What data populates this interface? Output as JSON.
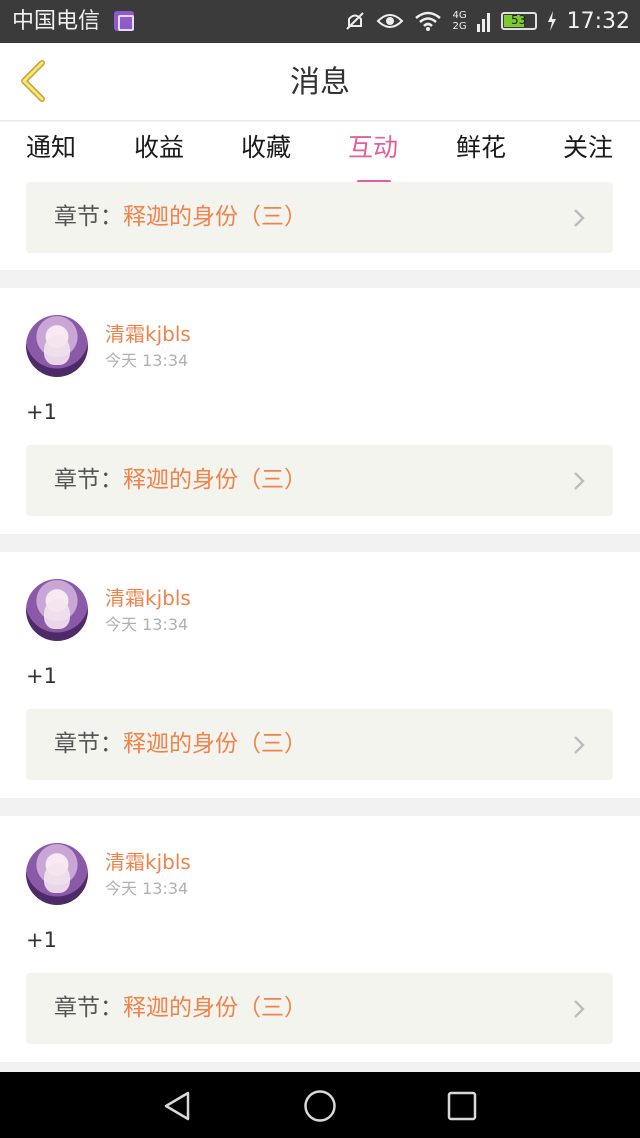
{
  "status_bar": {
    "carrier": "中国电信",
    "network": "4G\n2G",
    "battery": "53",
    "time": "17:32",
    "icons": [
      "carrier-app-icon",
      "mute-icon",
      "eye-icon",
      "wifi-icon",
      "signal-icon",
      "battery-icon",
      "charging-icon"
    ]
  },
  "nav": {
    "title": "消息",
    "back_icon": "chevron-left-icon"
  },
  "tabs": [
    {
      "label": "通知",
      "active": false
    },
    {
      "label": "收益",
      "active": false
    },
    {
      "label": "收藏",
      "active": false
    },
    {
      "label": "互动",
      "active": true
    },
    {
      "label": "鲜花",
      "active": false
    },
    {
      "label": "关注",
      "active": false
    }
  ],
  "colors": {
    "accent_pink": "#e75c9a",
    "accent_orange": "#f0824b"
  },
  "items": [
    {
      "username": "",
      "time": "",
      "message": "",
      "chapter_prefix": "章节：",
      "chapter_name": "释迦的身份（三）"
    },
    {
      "username": "清霜kjbls",
      "time": "今天 13:34",
      "message": "+1",
      "chapter_prefix": "章节：",
      "chapter_name": "释迦的身份（三）"
    },
    {
      "username": "清霜kjbls",
      "time": "今天 13:34",
      "message": "+1",
      "chapter_prefix": "章节：",
      "chapter_name": "释迦的身份（三）"
    },
    {
      "username": "清霜kjbls",
      "time": "今天 13:34",
      "message": "+1",
      "chapter_prefix": "章节：",
      "chapter_name": "释迦的身份（三）"
    }
  ],
  "system_nav": {
    "buttons": [
      "back-triangle-icon",
      "home-circle-icon",
      "recents-square-icon"
    ]
  }
}
